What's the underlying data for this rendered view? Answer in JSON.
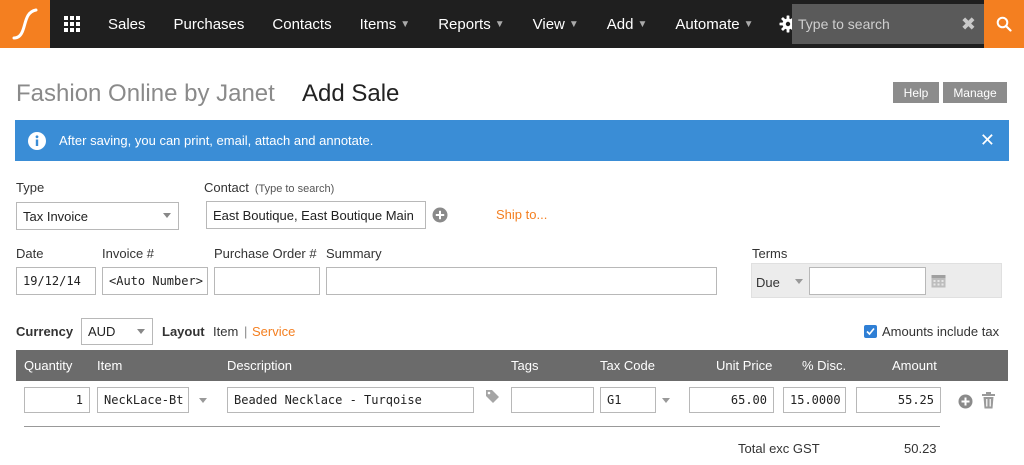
{
  "nav": {
    "items": [
      {
        "label": "Sales",
        "has_caret": false
      },
      {
        "label": "Purchases",
        "has_caret": false
      },
      {
        "label": "Contacts",
        "has_caret": false
      },
      {
        "label": "Items",
        "has_caret": true
      },
      {
        "label": "Reports",
        "has_caret": true
      },
      {
        "label": "View",
        "has_caret": true
      },
      {
        "label": "Add",
        "has_caret": true
      },
      {
        "label": "Automate",
        "has_caret": true
      }
    ],
    "search_placeholder": "Type to search",
    "accent": "#f47f20"
  },
  "header": {
    "org_name": "Fashion Online by Janet",
    "title": "Add Sale",
    "help_label": "Help",
    "manage_label": "Manage"
  },
  "banner": {
    "text": "After saving, you can print, email, attach and annotate.",
    "color": "#3a8dd6"
  },
  "form": {
    "type_label": "Type",
    "type_value": "Tax Invoice",
    "contact_label": "Contact",
    "contact_hint": "(Type to search)",
    "contact_value": "East Boutique, East Boutique Main",
    "ship_to": "Ship to...",
    "date_label": "Date",
    "date_value": "19/12/14",
    "invoice_label": "Invoice #",
    "invoice_value": "<Auto Number>",
    "po_label": "Purchase Order #",
    "po_value": "",
    "summary_label": "Summary",
    "summary_value": "",
    "terms_label": "Terms",
    "terms_value": "Due",
    "terms_days": "",
    "currency_label": "Currency",
    "currency_value": "AUD",
    "layout_label": "Layout",
    "layout_item": "Item",
    "layout_sep": "|",
    "layout_service": "Service",
    "amounts_include_tax": "Amounts include tax"
  },
  "table": {
    "headers": [
      "Quantity",
      "Item",
      "Description",
      "Tags",
      "Tax Code",
      "Unit Price",
      "% Disc.",
      "Amount"
    ],
    "row": {
      "quantity": "1",
      "item": "NeckLace-Bt",
      "description": "Beaded Necklace - Turqoise",
      "tags": "",
      "tax_code": "G1",
      "unit_price": "65.00",
      "discount": "15.0000",
      "amount": "55.25"
    }
  },
  "totals": {
    "label": "Total exc GST",
    "value": "50.23"
  }
}
